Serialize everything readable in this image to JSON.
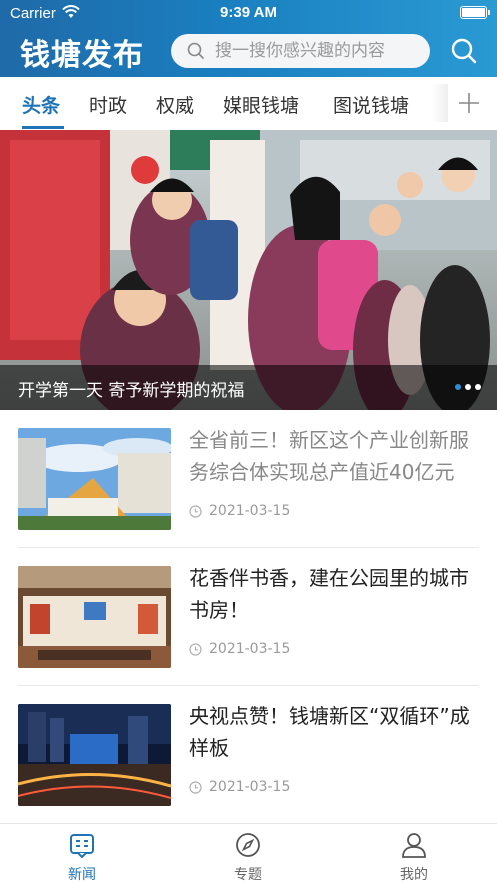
{
  "status_bar": {
    "carrier": "Carrier",
    "time": "9:39 AM"
  },
  "header": {
    "brand": "钱塘发布",
    "search_placeholder": "搜一搜你感兴趣的内容"
  },
  "tabs": [
    {
      "label": "头条",
      "active": true
    },
    {
      "label": "时政",
      "active": false
    },
    {
      "label": "权威",
      "active": false
    },
    {
      "label": "媒眼钱塘",
      "active": false
    },
    {
      "label": "图说钱塘",
      "active": false
    }
  ],
  "hero": {
    "caption": "开学第一天 寄予新学期的祝福",
    "slides": 3,
    "current": 1
  },
  "news": [
    {
      "title": "全省前三！新区这个产业创新服务综合体实现总产值近40亿元",
      "date": "2021-03-15",
      "read": true,
      "thumb": "building"
    },
    {
      "title": "花香伴书香，建在公园里的城市书房！",
      "date": "2021-03-15",
      "read": false,
      "thumb": "library"
    },
    {
      "title": "央视点赞！钱塘新区“双循环”成样板",
      "date": "2021-03-15",
      "read": false,
      "thumb": "citynight"
    }
  ],
  "tabbar": [
    {
      "label": "新闻",
      "icon": "news-icon",
      "active": true
    },
    {
      "label": "专题",
      "icon": "compass-icon",
      "active": false
    },
    {
      "label": "我的",
      "icon": "user-icon",
      "active": false
    }
  ],
  "colors": {
    "accent": "#1f73b7",
    "header_start": "#1f6aa8",
    "header_end": "#2a9ad3"
  }
}
